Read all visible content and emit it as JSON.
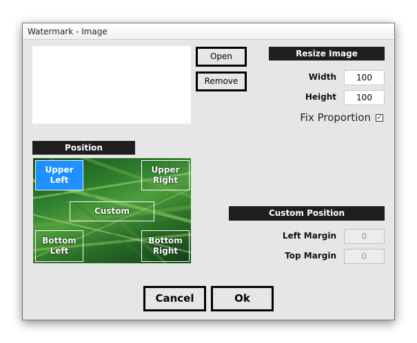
{
  "window": {
    "title": "Watermark - Image"
  },
  "image": {
    "open_label": "Open",
    "remove_label": "Remove"
  },
  "resize": {
    "header": "Resize Image",
    "width_label": "Width",
    "width_value": "100",
    "height_label": "Height",
    "height_value": "100",
    "fix_label": "Fix Proportion",
    "fix_checked": true
  },
  "position": {
    "header": "Position",
    "upper_left": "Upper\nLeft",
    "upper_right": "Upper\nRight",
    "custom": "Custom",
    "bottom_left": "Bottom\nLeft",
    "bottom_right": "Bottom\nRight",
    "selected": "upper_left"
  },
  "custom_position": {
    "header": "Custom Position",
    "left_label": "Left Margin",
    "left_value": "0",
    "top_label": "Top Margin",
    "top_value": "0"
  },
  "footer": {
    "cancel_label": "Cancel",
    "ok_label": "Ok"
  },
  "colors": {
    "selected": "#1e90ff",
    "header_bg": "#1e1e1e",
    "dialog_bg": "#e6e6e6"
  }
}
